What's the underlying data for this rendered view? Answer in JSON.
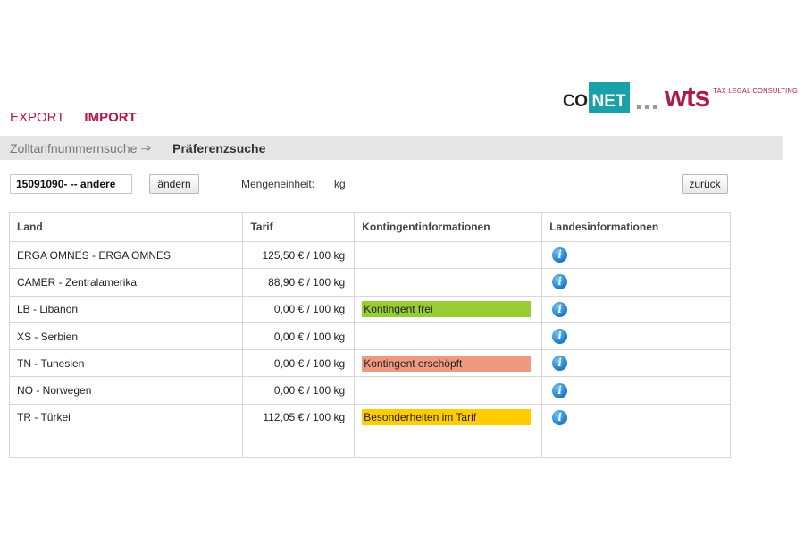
{
  "logos": {
    "conet_co": "CO",
    "conet_net": "NET",
    "wts_mark": "wts",
    "wts_tagline": "TAX LEGAL CONSULTING"
  },
  "nav": {
    "export": "EXPORT",
    "import": "IMPORT"
  },
  "breadcrumb": {
    "first": "Zolltarifnummernsuche",
    "arrow": "⇒",
    "current": "Präferenzsuche"
  },
  "controls": {
    "tarif_value": "15091090- -- andere",
    "change_button": "ändern",
    "unit_label": "Mengeneinheit:",
    "unit_value": "kg",
    "back_button": "zurück"
  },
  "table": {
    "headers": [
      "Land",
      "Tarif",
      "Kontingentinformationen",
      "Landesinformationen"
    ],
    "rows": [
      {
        "land": "ERGA OMNES - ERGA OMNES",
        "tarif": "125,50 € / 100 kg",
        "kontingent": "",
        "kontingent_color": ""
      },
      {
        "land": "CAMER - Zentralamerika",
        "tarif": "88,90 € / 100 kg",
        "kontingent": "",
        "kontingent_color": ""
      },
      {
        "land": "LB - Libanon",
        "tarif": "0,00 € / 100 kg",
        "kontingent": "Kontingent frei",
        "kontingent_color": "#99cc33"
      },
      {
        "land": "XS - Serbien",
        "tarif": "0,00 € / 100 kg",
        "kontingent": "",
        "kontingent_color": ""
      },
      {
        "land": "TN - Tunesien",
        "tarif": "0,00 € / 100 kg",
        "kontingent": "Kontingent erschöpft",
        "kontingent_color": "#ee9980"
      },
      {
        "land": "NO - Norwegen",
        "tarif": "0,00 € / 100 kg",
        "kontingent": "",
        "kontingent_color": ""
      },
      {
        "land": "TR - Türkei",
        "tarif": "112,05 € / 100 kg",
        "kontingent": "Besonderheiten im Tarif",
        "kontingent_color": "#ffcc00"
      }
    ],
    "info_icon": "info-icon",
    "info_glyph": "i"
  },
  "colors": {
    "brand": "#b0174b",
    "conet_teal": "#1aa0a8",
    "crumb_bar": "#e5e5e5"
  }
}
